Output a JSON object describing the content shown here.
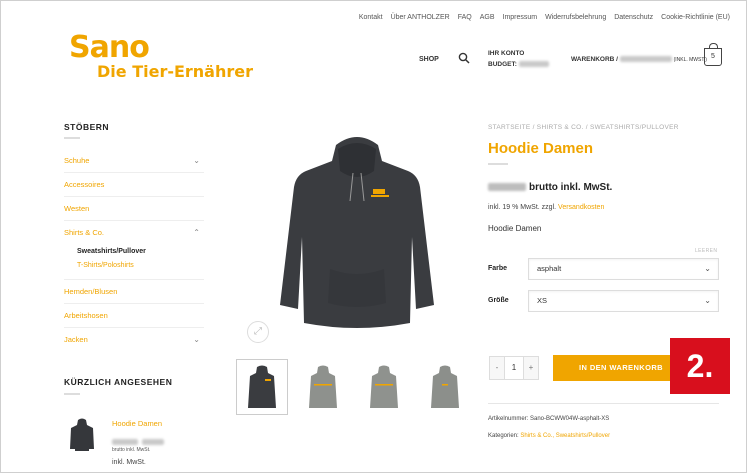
{
  "topnav": [
    "Kontakt",
    "Über ANTHOLZER",
    "FAQ",
    "AGB",
    "Impressum",
    "Widerrufsbelehrung",
    "Datenschutz",
    "Cookie-Richtlinie (EU)"
  ],
  "logo": {
    "main": "Sano",
    "sub": "Die Tier-Ernährer"
  },
  "header": {
    "shop": "SHOP",
    "account_title": "IHR KONTO",
    "budget_label": "BUDGET:",
    "cart_label": "WARENKORB /",
    "cart_suffix": "(INKL. MWST.)",
    "cart_count": "5"
  },
  "sidebar": {
    "title": "STÖBERN",
    "items": [
      "Schuhe",
      "Accessoires",
      "Westen",
      "Shirts & Co.",
      "Hemden/Blusen",
      "Arbeitshosen",
      "Jacken"
    ],
    "sub_active": "Sweatshirts/Pullover",
    "sub_link": "T-Shirts/Poloshirts",
    "recent_title": "KÜRZLICH ANGESEHEN",
    "recent_name": "Hoodie Damen",
    "recent_brutto": "brutto inkl. MwSt.",
    "recent_inkl": "inkl. MwSt."
  },
  "product": {
    "breadcrumb": "STARTSEITE / SHIRTS & CO. / SWEATSHIRTS/PULLOVER",
    "title": "Hoodie Damen",
    "price_suffix": "brutto inkl. MwSt.",
    "tax": "inkl. 19 % MwSt. zzgl.",
    "tax_link": "Versandkosten",
    "description": "Hoodie Damen",
    "leeren": "LEEREN",
    "farbe_label": "Farbe",
    "farbe_value": "asphalt",
    "groesse_label": "Größe",
    "groesse_value": "XS",
    "qty_minus": "-",
    "qty_value": "1",
    "qty_plus": "+",
    "add_to_cart": "IN DEN WARENKORB",
    "sku": "Artikelnummer: Sano-BCWW04W-asphalt-XS",
    "categories_label": "Kategorien:",
    "categories_value": "Shirts & Co., Sweatshirts/Pullover"
  },
  "badge": "2.",
  "colors": {
    "accent": "#f0a500",
    "badge": "#d80f1d",
    "hoodie_dark": "#3a3c40",
    "hoodie_gray": "#8e918d"
  },
  "icons": [
    "search-icon",
    "cart-icon",
    "chevron-down-icon",
    "chevron-up-icon",
    "zoom-icon"
  ]
}
